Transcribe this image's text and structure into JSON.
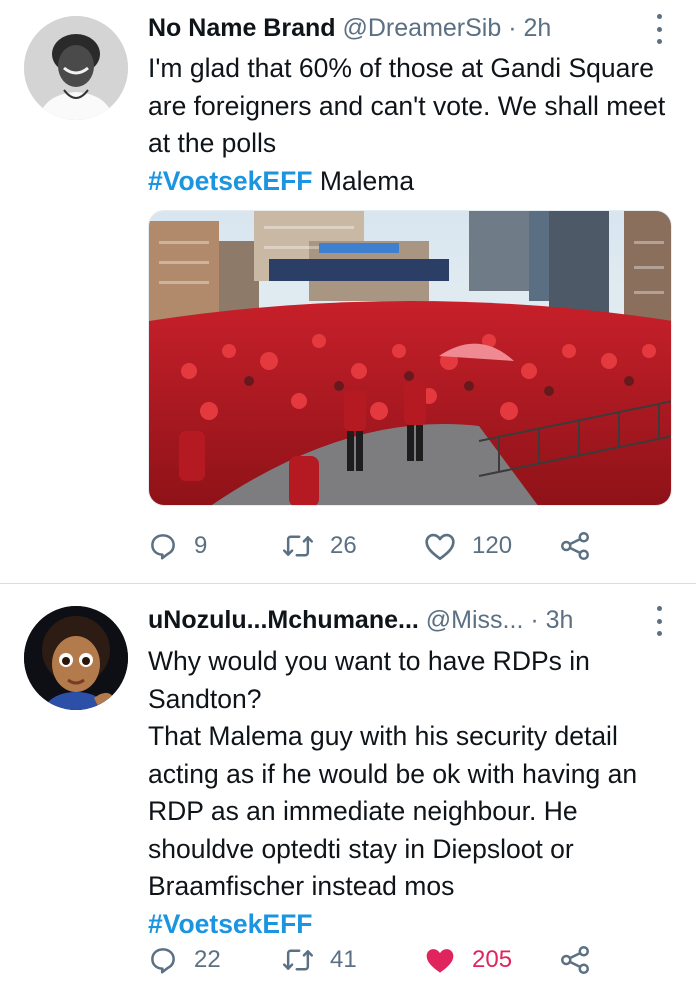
{
  "tweets": [
    {
      "author_name": "No Name Brand",
      "handle": "@DreamerSib",
      "separator": "·",
      "time": "2h",
      "text_lines": [
        "I'm glad that 60% of those at Gandi Square are foreigners and can't vote. We shall meet at the polls"
      ],
      "hashtag": "#VoetsekEFF",
      "hashtag_suffix": " Malema",
      "has_media": true,
      "media_icon": "crowd-photo",
      "stats": {
        "replies": "9",
        "retweets": "26",
        "likes": "120"
      },
      "liked": false,
      "icons": [
        "reply-icon",
        "retweet-icon",
        "like-icon",
        "share-icon",
        "more-icon"
      ]
    },
    {
      "author_name": "uNozulu...Mchumane...",
      "handle": "@Miss...",
      "separator": "·",
      "time": "3h",
      "text_lines": [
        "Why would you want to have RDPs in Sandton?",
        "That Malema guy with his security detail acting as if he would be ok with having an RDP as an immediate neighbour. He shouldve optedti stay in Diepsloot or Braamfischer instead mos"
      ],
      "hashtag": "#VoetsekEFF",
      "hashtag_suffix": "",
      "has_media": false,
      "stats": {
        "replies": "22",
        "retweets": "41",
        "likes": "205"
      },
      "liked": true,
      "like_color": "#e0245e",
      "icons": [
        "reply-icon",
        "retweet-icon",
        "like-filled-icon",
        "share-icon",
        "more-icon"
      ]
    }
  ],
  "colors": {
    "hashtag": "#1b95e0",
    "secondary_text": "#5b7083",
    "primary_text": "#0f1419",
    "divider": "#d9dde0"
  }
}
